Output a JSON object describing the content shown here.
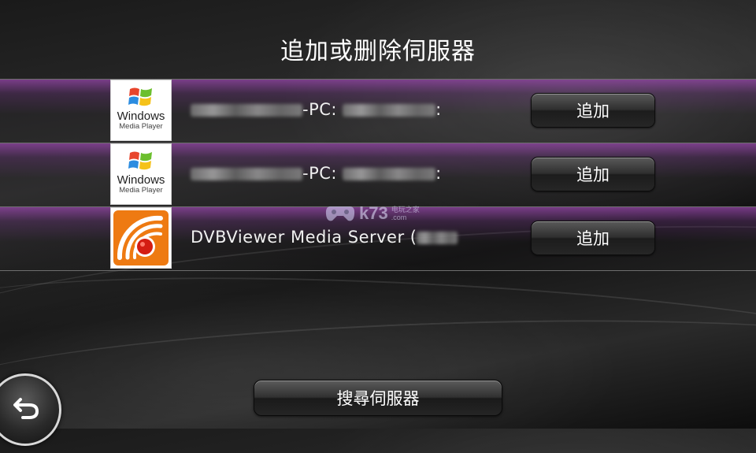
{
  "title": "追加或删除伺服器",
  "servers": [
    {
      "logo": "windows-media-player-logo",
      "logo_text_1": "Windows",
      "logo_text_2": "Media Player",
      "name_suffix": "-PC:",
      "name_tail": ":",
      "add_label": "追加"
    },
    {
      "logo": "windows-media-player-logo",
      "logo_text_1": "Windows",
      "logo_text_2": "Media Player",
      "name_suffix": "-PC:",
      "name_tail": ":",
      "add_label": "追加"
    },
    {
      "logo": "dvbviewer-logo",
      "name": "DVBViewer Media Server (",
      "add_label": "追加"
    }
  ],
  "watermark": {
    "text": "k73",
    "sub": "电玩之家",
    "sub2": ".com"
  },
  "search_button": {
    "label": "搜尋伺服器"
  },
  "back_button": {
    "icon": "back-arrow-icon"
  }
}
